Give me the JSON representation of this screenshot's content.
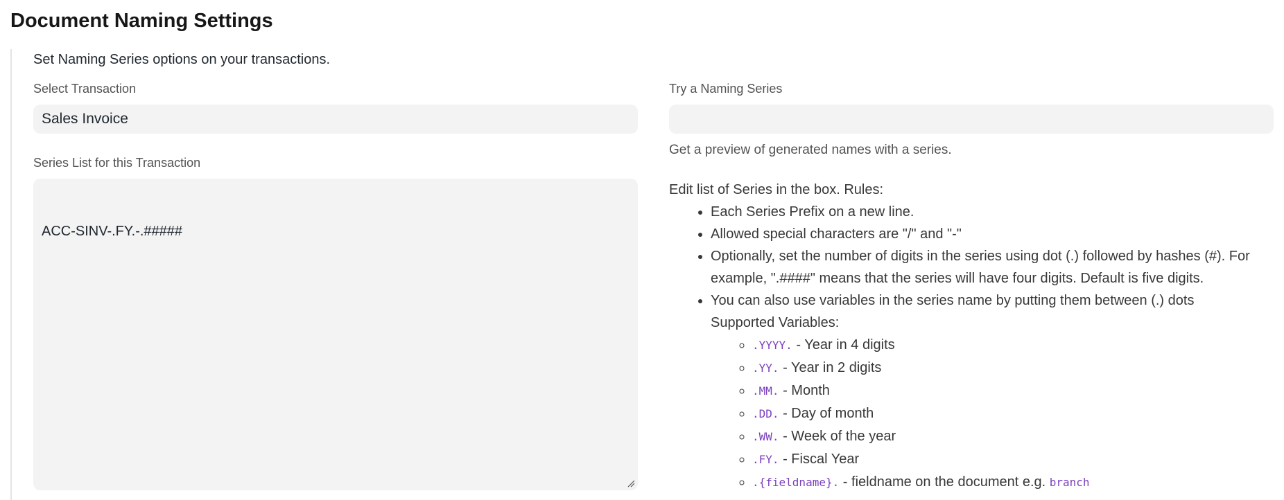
{
  "page": {
    "title": "Document Naming Settings",
    "section_description": "Set Naming Series options on your transactions."
  },
  "transaction": {
    "label": "Select Transaction",
    "value": "Sales Invoice"
  },
  "series_list": {
    "label": "Series List for this Transaction",
    "value": "\nACC-SINV-.FY.-.#####"
  },
  "try_series": {
    "label": "Try a Naming Series",
    "value": "",
    "help": "Get a preview of generated names with a series."
  },
  "rules": {
    "title": "Edit list of Series in the box. Rules:",
    "items": [
      "Each Series Prefix on a new line.",
      "Allowed special characters are \"/\" and \"-\"",
      "Optionally, set the number of digits in the series using dot (.) followed by hashes (#). For example, \".####\" means that the series will have four digits. Default is five digits."
    ],
    "variables_intro_line1": "You can also use variables in the series name by putting them between (.) dots",
    "variables_intro_line2": "Supported Variables:",
    "variables": [
      {
        "code": ".YYYY.",
        "desc": " - Year in 4 digits"
      },
      {
        "code": ".YY.",
        "desc": " - Year in 2 digits"
      },
      {
        "code": ".MM.",
        "desc": " - Month"
      },
      {
        "code": ".DD.",
        "desc": " - Day of month"
      },
      {
        "code": ".WW.",
        "desc": " - Week of the year"
      },
      {
        "code": ".FY.",
        "desc": " - Fiscal Year"
      }
    ],
    "fieldname_var": {
      "code": ".{fieldname}.",
      "desc": " - fieldname on the document e.g. ",
      "example": "branch"
    }
  },
  "colors": {
    "input_bg": "#f3f3f3",
    "code_purple": "#7b3fbd",
    "border": "#e4e4e4"
  }
}
